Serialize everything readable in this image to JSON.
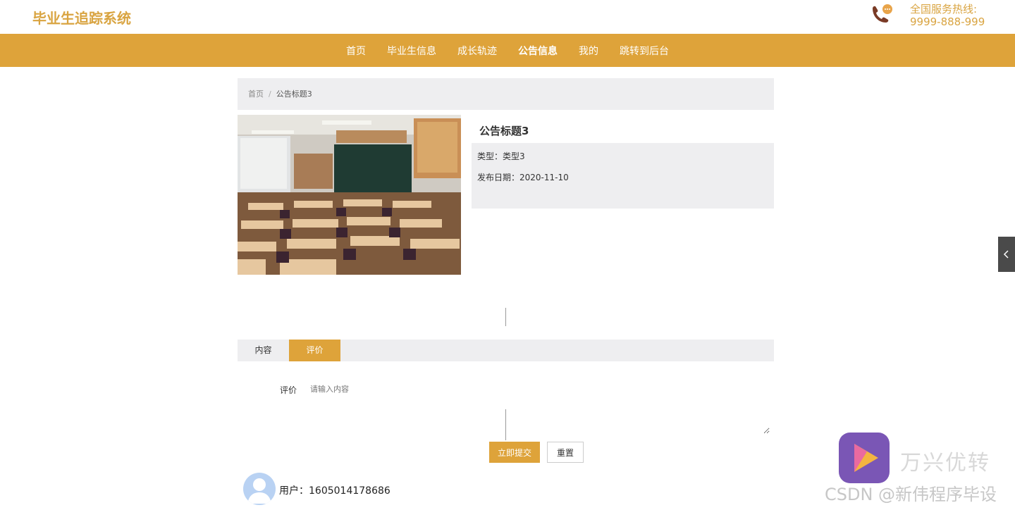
{
  "header": {
    "logo": "毕业生追踪系统",
    "hotline_label": "全国服务热线:",
    "hotline_number": "9999-888-999",
    "brand_color": "#d9a441"
  },
  "nav": {
    "items": [
      {
        "label": "首页",
        "active": false
      },
      {
        "label": "毕业生信息",
        "active": false
      },
      {
        "label": "成长轨迹",
        "active": false
      },
      {
        "label": "公告信息",
        "active": true
      },
      {
        "label": "我的",
        "active": false
      },
      {
        "label": "跳转到后台",
        "active": false
      }
    ],
    "bg_color": "#dea33a"
  },
  "breadcrumb": {
    "home": "首页",
    "separator": "/",
    "current": "公告标题3"
  },
  "detail": {
    "title": "公告标题3",
    "type_label": "类型：",
    "type_value": "类型3",
    "date_label": "发布日期：",
    "date_value": "2020-11-10"
  },
  "tabs": [
    {
      "label": "内容",
      "active": false
    },
    {
      "label": "评价",
      "active": true
    }
  ],
  "form": {
    "label": "评价",
    "placeholder": "请输入内容",
    "submit_label": "立即提交",
    "reset_label": "重置"
  },
  "comments": [
    {
      "user_label": "用户：",
      "user_id": "1605014178686"
    }
  ],
  "watermark": {
    "app_name": "万兴优转",
    "csdn": "CSDN @新伟程序毕设"
  }
}
